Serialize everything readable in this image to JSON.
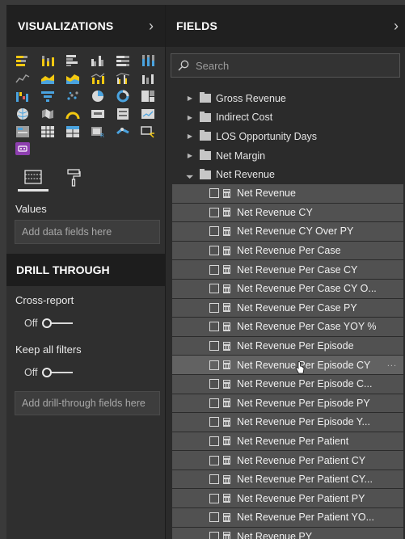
{
  "visualizations": {
    "title": "VISUALIZATIONS",
    "collapse_icon": "chevron-right-icon",
    "icons": [
      "stacked-bar-chart-icon",
      "stacked-column-chart-icon",
      "clustered-bar-chart-icon",
      "clustered-column-chart-icon",
      "100-stacked-bar-chart-icon",
      "100-stacked-column-chart-icon",
      "line-chart-icon",
      "area-chart-icon",
      "stacked-area-chart-icon",
      "line-and-stacked-column-icon",
      "line-and-clustered-column-icon",
      "ribbon-chart-icon",
      "waterfall-chart-icon",
      "funnel-icon",
      "scatter-chart-icon",
      "pie-chart-icon",
      "donut-chart-icon",
      "treemap-icon",
      "map-icon",
      "filled-map-icon",
      "gauge-icon",
      "card-icon",
      "multi-row-card-icon",
      "kpi-icon",
      "slicer-icon",
      "table-icon",
      "matrix-icon",
      "r-visual-icon",
      "arcgis-icon",
      "custom-visual-icon",
      "custom-purple-visual-icon"
    ],
    "tabs": {
      "fields_tab_icon": "fields-well-icon",
      "format_tab_icon": "paint-roller-icon"
    },
    "values_label": "Values",
    "values_placeholder": "Add data fields here"
  },
  "drill_through": {
    "title": "DRILL THROUGH",
    "cross_report_label": "Cross-report",
    "cross_report_state": "Off",
    "keep_filters_label": "Keep all filters",
    "keep_filters_state": "Off",
    "drop_placeholder": "Add drill-through fields here"
  },
  "fields": {
    "title": "FIELDS",
    "collapse_icon": "chevron-right-icon",
    "search_placeholder": "Search",
    "tables": [
      {
        "name": "Gross Revenue",
        "expanded": false
      },
      {
        "name": "Indirect Cost",
        "expanded": false
      },
      {
        "name": "LOS Opportunity Days",
        "expanded": false
      },
      {
        "name": "Net Margin",
        "expanded": false
      },
      {
        "name": "Net Revenue",
        "expanded": true
      }
    ],
    "measures": [
      "Net Revenue",
      "Net Revenue CY",
      "Net Revenue CY Over PY",
      "Net Revenue Per Case",
      "Net Revenue Per Case CY",
      "Net Revenue Per Case CY O...",
      "Net Revenue Per Case PY",
      "Net Revenue Per Case YOY %",
      "Net Revenue Per Episode",
      "Net Revenue Per Episode CY",
      "Net Revenue Per Episode C...",
      "Net Revenue Per Episode PY",
      "Net Revenue Per Episode Y...",
      "Net Revenue Per Patient",
      "Net Revenue Per Patient CY",
      "Net Revenue Per Patient CY...",
      "Net Revenue Per Patient PY",
      "Net Revenue Per Patient YO...",
      "Net Revenue PY"
    ],
    "more_options": "...",
    "hovered_index": 9
  }
}
